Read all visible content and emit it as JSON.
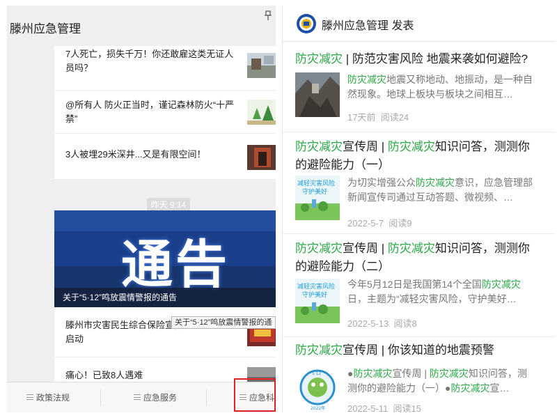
{
  "left": {
    "title": "滕州应急管理",
    "rows": [
      {
        "text": "7人死亡，损失千万！你还敢雇这类无证人员吗？"
      },
      {
        "text": "@所有人 防火正当时，谨记森林防火“十严禁”"
      },
      {
        "text": "3人被埋29米深井...又是有限空间！"
      }
    ],
    "time_chip": "昨天  9:14",
    "banner": {
      "big_text": "通告",
      "caption": "关于“5·12”鸣放震情警报的通告"
    },
    "card2_rows": [
      {
        "text": "滕州市灾害民生综合保险宣传"
      },
      {
        "text": "启动"
      },
      {
        "text": "痛心！已致8人遇难"
      }
    ],
    "tooltip": "关于“5·12”鸣放震情警报的通",
    "tabs": [
      "政策法规",
      "应急服务",
      "应急科普"
    ]
  },
  "right": {
    "author": "滕州应急管理 发表",
    "articles": [
      {
        "title_parts": [
          {
            "t": "防灾减灾",
            "hl": true
          },
          {
            "t": " | 防范灾害风险 地震来袭如何避险?",
            "hl": false
          }
        ],
        "summary_parts": [
          {
            "t": "防灾减灾",
            "hl": true
          },
          {
            "t": "地震又称地动、地振动，是一种自然现象。地球上板块与板块之间相互…",
            "hl": false
          }
        ],
        "date": "17天前",
        "reads": "阅读24"
      },
      {
        "title_parts": [
          {
            "t": "防灾减灾",
            "hl": true
          },
          {
            "t": "宣传周 | ",
            "hl": false
          },
          {
            "t": "防灾减灾",
            "hl": true
          },
          {
            "t": "知识问答，测测你的避险能力（一）",
            "hl": false
          }
        ],
        "summary_parts": [
          {
            "t": "为切实增强公众",
            "hl": false
          },
          {
            "t": "防灾减灾",
            "hl": true
          },
          {
            "t": "意识，应急管理部新闻宣传司通过互动答题、微视频、…",
            "hl": false
          }
        ],
        "date": "2022-5-7",
        "reads": "阅读9"
      },
      {
        "title_parts": [
          {
            "t": "防灾减灾",
            "hl": true
          },
          {
            "t": "宣传周 | ",
            "hl": false
          },
          {
            "t": "防灾减灾",
            "hl": true
          },
          {
            "t": "知识问答，测测你的避险能力（二）",
            "hl": false
          }
        ],
        "summary_parts": [
          {
            "t": "今年5月12日是我国第14个全国",
            "hl": false
          },
          {
            "t": "防灾减灾",
            "hl": true
          },
          {
            "t": "日，主题为“减轻灾害风险，守护美好…",
            "hl": false
          }
        ],
        "date": "2022-5-13",
        "reads": "阅读8"
      },
      {
        "title_parts": [
          {
            "t": "防灾减灾",
            "hl": true
          },
          {
            "t": "宣传周 | 你该知道的地震预警",
            "hl": false
          }
        ],
        "summary_parts": [
          {
            "t": "●",
            "hl": false
          },
          {
            "t": "防灾减灾",
            "hl": true
          },
          {
            "t": "宣传周 | ",
            "hl": false
          },
          {
            "t": "防灾减灾",
            "hl": true
          },
          {
            "t": "知识问答，测测你的避险能力（一）●",
            "hl": false
          },
          {
            "t": "防灾减灾",
            "hl": true
          },
          {
            "t": "宣…",
            "hl": false
          }
        ],
        "date": "2022-5-11",
        "reads": "阅读15"
      }
    ],
    "thumb_text": {
      "line1": "减轻灾害风险",
      "line2": "守护美好",
      "badge_top": "5·12",
      "badge_bottom": "2022年"
    }
  },
  "colors": {
    "highlight": "#2aa745",
    "banner_bg": "#1a3f8a",
    "alert_border": "#e02020"
  }
}
